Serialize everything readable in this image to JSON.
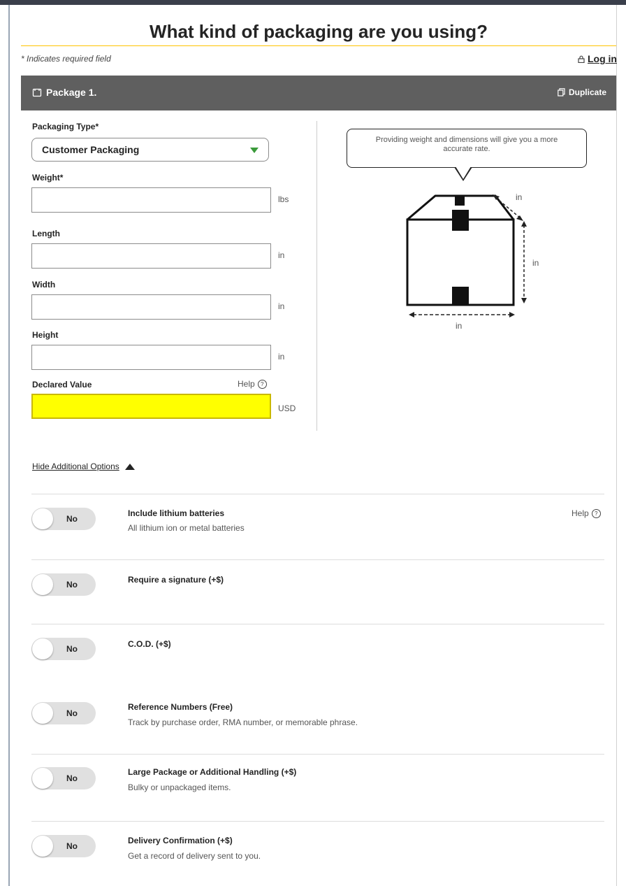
{
  "page": {
    "title": "What kind of packaging are you using?",
    "required_note": "* Indicates required field",
    "login_label": "Log in"
  },
  "package": {
    "header": "Package 1.",
    "duplicate_label": "Duplicate"
  },
  "form": {
    "packaging_type_label": "Packaging Type*",
    "packaging_type_value": "Customer Packaging",
    "weight_label": "Weight*",
    "weight_value": "",
    "weight_unit": "lbs",
    "length_label": "Length",
    "length_value": "",
    "length_unit": "in",
    "width_label": "Width",
    "width_value": "",
    "width_unit": "in",
    "height_label": "Height",
    "height_value": "",
    "height_unit": "in",
    "declared_value_label": "Declared Value",
    "declared_value_value": "",
    "declared_value_unit": "USD",
    "help_label": "Help"
  },
  "diagram": {
    "tip": "Providing weight and dimensions will give you a more accurate rate.",
    "depth_unit": "in",
    "height_unit": "in",
    "width_unit": "in"
  },
  "options_toggle": "Hide Additional Options",
  "options": [
    {
      "toggle": "No",
      "title": "Include lithium batteries",
      "desc": "All lithium ion or metal batteries",
      "help": "Help"
    },
    {
      "toggle": "No",
      "title": "Require a signature (+$)",
      "desc": ""
    },
    {
      "toggle": "No",
      "title": "C.O.D. (+$)",
      "desc": ""
    },
    {
      "toggle": "No",
      "title": "Reference Numbers (Free)",
      "desc": "Track by purchase order, RMA number, or memorable phrase."
    },
    {
      "toggle": "No",
      "title": "Large Package or Additional Handling (+$)",
      "desc": "Bulky or unpackaged items."
    },
    {
      "toggle": "No",
      "title": "Delivery Confirmation (+$)",
      "desc": "Get a record of delivery sent to you."
    }
  ],
  "colors": {
    "header_bg": "#5f5f5f",
    "accent_rule": "#ffc400",
    "declared_highlight": "#ffff00",
    "select_arrow": "#3a9a3a"
  }
}
